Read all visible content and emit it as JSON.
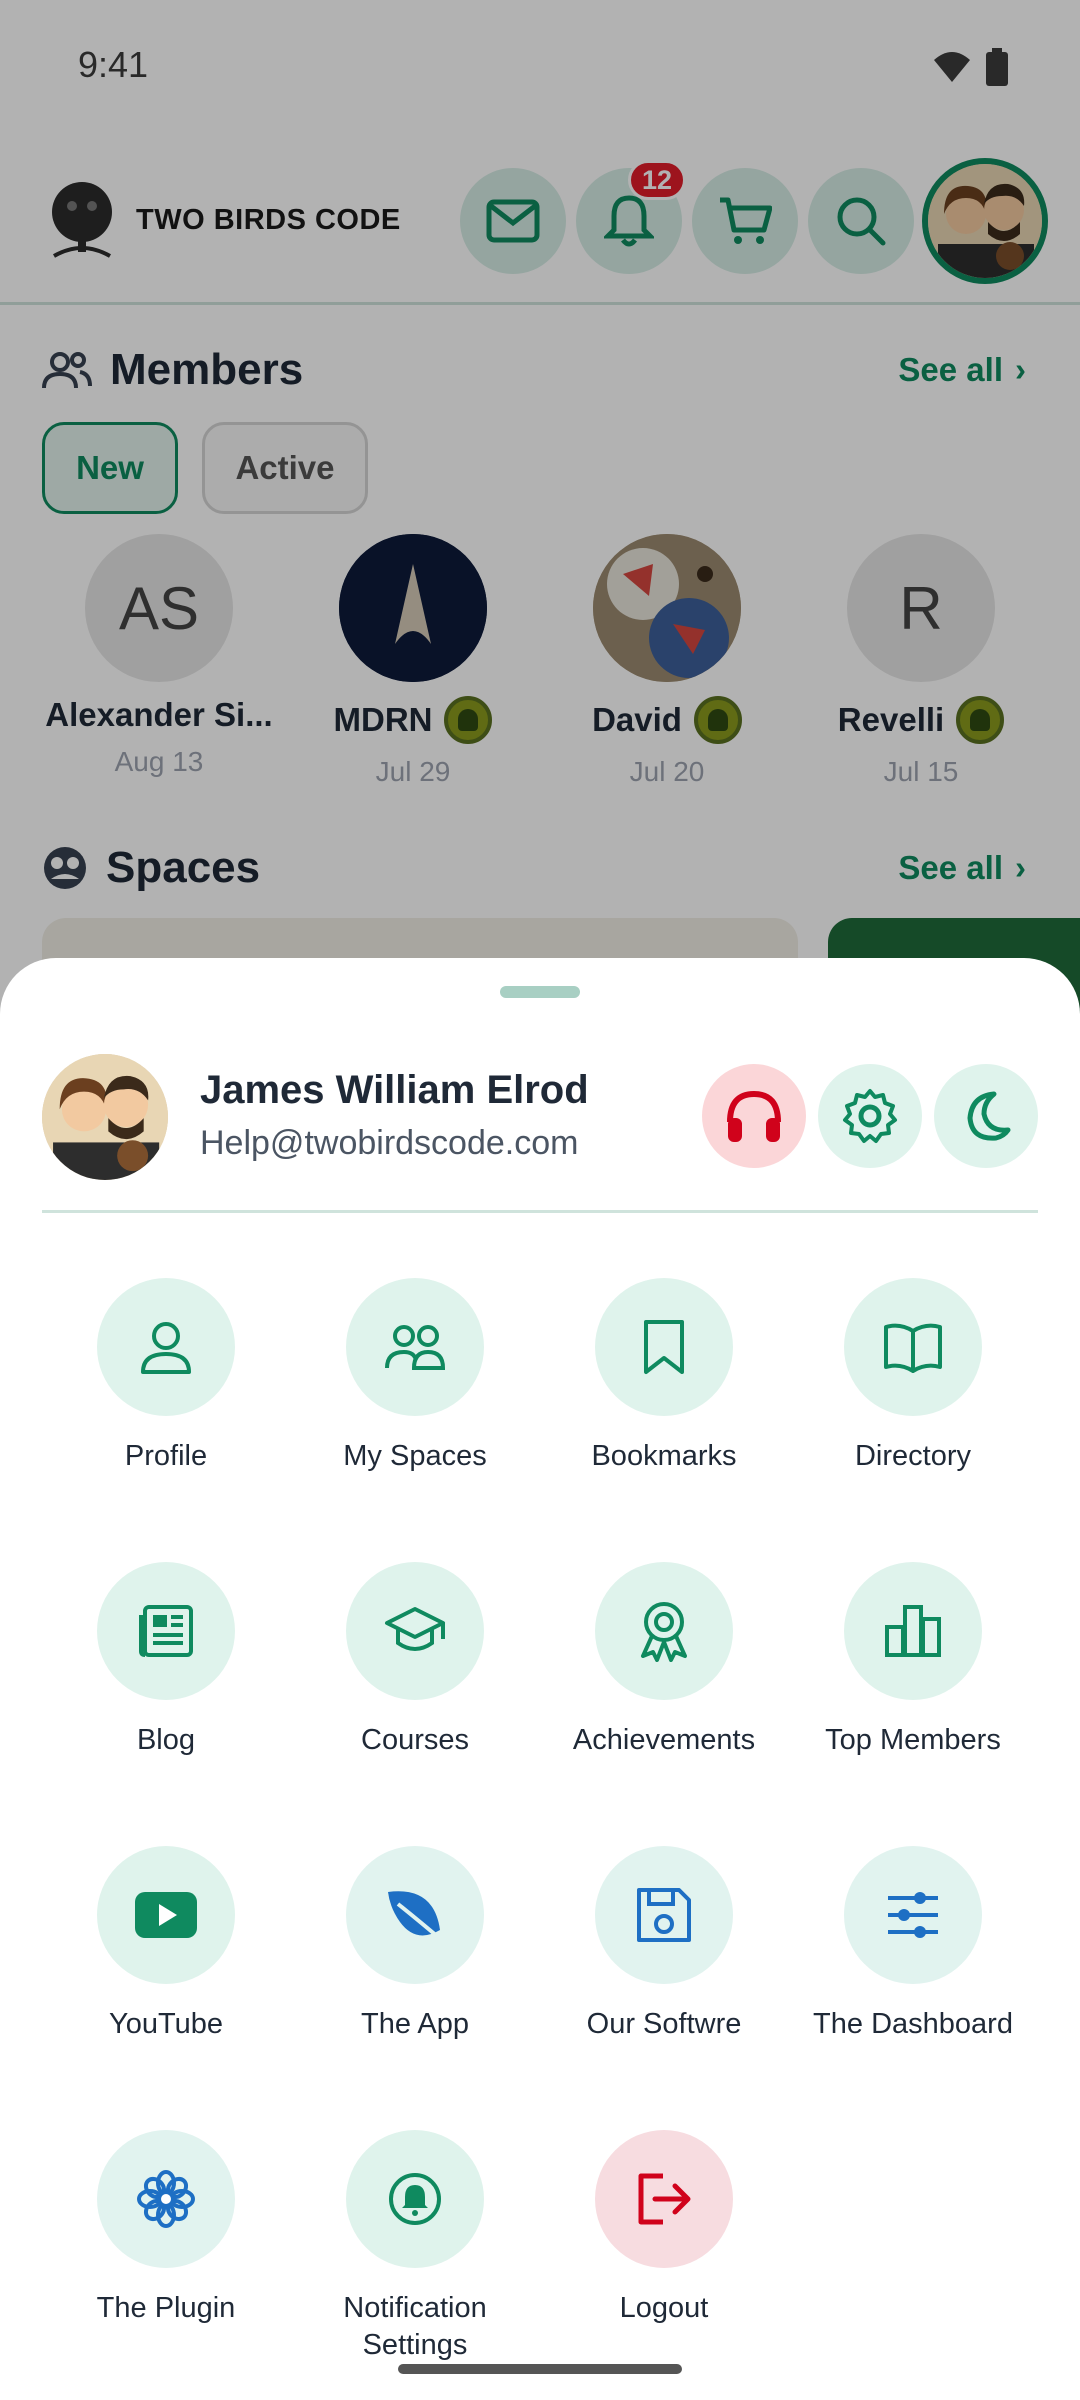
{
  "status": {
    "time": "9:41"
  },
  "header": {
    "brand": "TWO BIRDS CODE",
    "notification_count": "12"
  },
  "members": {
    "title": "Members",
    "see_all": "See all",
    "filters": [
      "New",
      "Active"
    ],
    "items": [
      {
        "name": "Alexander Si...",
        "date": "Aug 13",
        "initials": "AS",
        "has_badge": false
      },
      {
        "name": "MDRN",
        "date": "Jul 29",
        "initials": "",
        "has_badge": true
      },
      {
        "name": "David",
        "date": "Jul 20",
        "initials": "",
        "has_badge": true
      },
      {
        "name": "Revelli",
        "date": "Jul 15",
        "initials": "R",
        "has_badge": true
      }
    ]
  },
  "spaces": {
    "title": "Spaces",
    "see_all": "See all"
  },
  "sheet": {
    "user_name": "James William Elrod",
    "user_email": "Help@twobirdscode.com",
    "menu": [
      {
        "label": "Profile",
        "icon": "person-icon"
      },
      {
        "label": "My Spaces",
        "icon": "group-icon"
      },
      {
        "label": "Bookmarks",
        "icon": "bookmark-icon"
      },
      {
        "label": "Directory",
        "icon": "book-icon"
      },
      {
        "label": "Blog",
        "icon": "newspaper-icon"
      },
      {
        "label": "Courses",
        "icon": "graduation-cap-icon"
      },
      {
        "label": "Achievements",
        "icon": "award-icon"
      },
      {
        "label": "Top Members",
        "icon": "bar-chart-icon"
      },
      {
        "label": "YouTube",
        "icon": "youtube-icon"
      },
      {
        "label": "The App",
        "icon": "leaf-icon"
      },
      {
        "label": "Our Softwre",
        "icon": "floppy-disk-icon"
      },
      {
        "label": "The Dashboard",
        "icon": "sliders-icon"
      },
      {
        "label": "The Plugin",
        "icon": "flower-icon"
      },
      {
        "label": "Notification Settings",
        "icon": "bell-circle-icon"
      },
      {
        "label": "Logout",
        "icon": "logout-icon"
      }
    ]
  },
  "colors": {
    "accent": "#0f8a5f",
    "danger": "#d0021b",
    "icon_bg": "#dff3ec",
    "blue_icon": "#1e6fc4"
  }
}
